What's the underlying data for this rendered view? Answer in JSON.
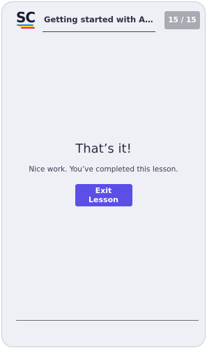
{
  "header": {
    "logo_text": "SC",
    "title": "Getting started with Andro…",
    "progress": "15 / 15"
  },
  "main": {
    "heading": "That’s it!",
    "message": "Nice work. You’ve completed this lesson.",
    "exit_label": "Exit Lesson"
  },
  "colors": {
    "accent": "#5b4fe8",
    "badge": "#a9abb3",
    "background": "#eef0f6",
    "logo_stripes": [
      "#1e88e5",
      "#fdd835",
      "#e91e63"
    ]
  }
}
